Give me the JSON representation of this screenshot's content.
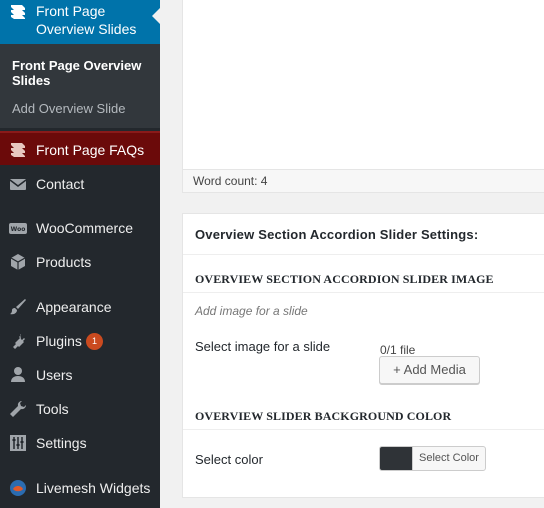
{
  "sidebar": {
    "active": {
      "label_line1": "Front Page",
      "label_line2": "Overview Slides"
    },
    "submenu": {
      "current": "Front Page Overview Slides",
      "add": "Add Overview Slide"
    },
    "faq": {
      "label": "Front Page FAQs"
    },
    "items": [
      {
        "label": "Contact",
        "icon": "envelope-icon"
      },
      {
        "label": "WooCommerce",
        "icon": "woocommerce-icon"
      },
      {
        "label": "Products",
        "icon": "cube-icon"
      },
      {
        "label": "Appearance",
        "icon": "paintbrush-icon"
      },
      {
        "label": "Plugins",
        "icon": "plug-icon",
        "badge": "1"
      },
      {
        "label": "Users",
        "icon": "user-icon"
      },
      {
        "label": "Tools",
        "icon": "wrench-icon"
      },
      {
        "label": "Settings",
        "icon": "sliders-icon"
      },
      {
        "label": "Livemesh Widgets",
        "icon": "livemesh-icon"
      }
    ]
  },
  "editor": {
    "word_count": "Word count: 4"
  },
  "metabox": {
    "title": "Overview Section Accordion Slider Settings:",
    "image_section": {
      "heading": "OVERVIEW SECTION ACCORDION SLIDER IMAGE",
      "description": "Add image for a slide",
      "field_label": "Select image for a slide",
      "file_count": "0/1 file",
      "button": "+ Add Media"
    },
    "color_section": {
      "heading": "OVERVIEW SLIDER BACKGROUND COLOR",
      "field_label": "Select color",
      "button": "Select Color",
      "swatch_color": "#2f3337"
    }
  },
  "colors": {
    "sidebar_bg": "#23282d",
    "active_bg": "#0073aa",
    "faq_bg": "#6b0a0a",
    "badge": "#ca4a1f"
  }
}
